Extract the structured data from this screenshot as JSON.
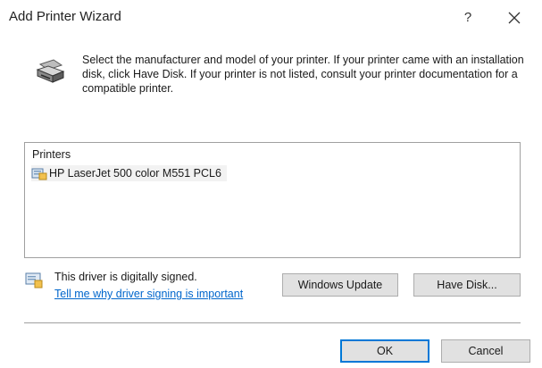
{
  "window": {
    "title": "Add Printer Wizard",
    "help_label": "?",
    "close_icon": "close-icon"
  },
  "header": {
    "icon": "printer-icon",
    "instructions": "Select the manufacturer and model of your printer. If your printer came with an installation disk, click Have Disk. If your printer is not listed, consult your printer documentation for a compatible printer."
  },
  "printers": {
    "header": "Printers",
    "items": [
      {
        "label": "HP LaserJet 500 color M551 PCL6",
        "icon": "printer-driver-icon"
      }
    ]
  },
  "driver_signing": {
    "icon": "signed-driver-icon",
    "status": "This driver is digitally signed.",
    "link": "Tell me why driver signing is important"
  },
  "buttons": {
    "windows_update": "Windows Update",
    "have_disk": "Have Disk...",
    "ok": "OK",
    "cancel": "Cancel"
  },
  "colors": {
    "link": "#0066cc",
    "default_button_border": "#0078d7"
  }
}
